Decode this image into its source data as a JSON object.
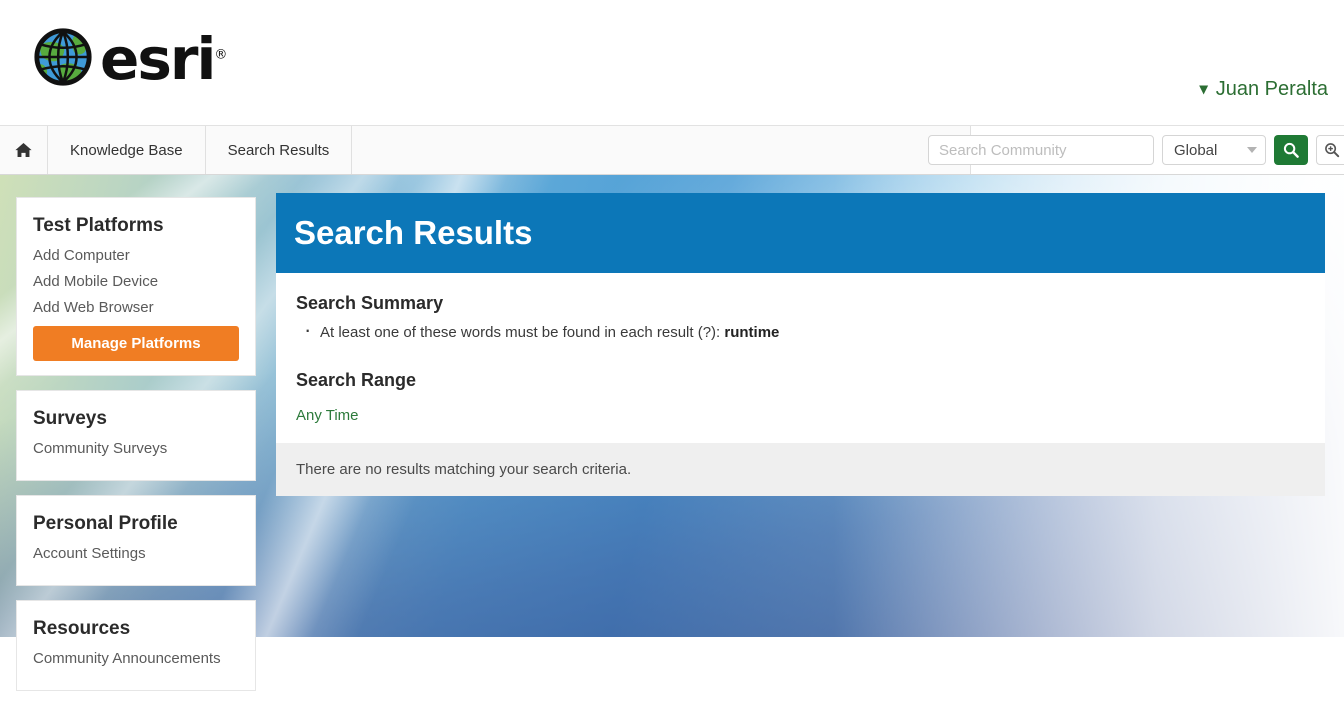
{
  "brand": {
    "logo_text": "esri",
    "registered_mark": "®",
    "globe_green": "#4a9e3f",
    "globe_blue": "#2f8fd0"
  },
  "header": {
    "user_name": "Juan Peralta",
    "user_menu_color": "#2c6e33",
    "chevron_icon": "chevron-down-icon"
  },
  "nav": {
    "home_icon": "home-icon",
    "items": [
      {
        "label": "Knowledge Base"
      },
      {
        "label": "Search Results"
      }
    ],
    "search": {
      "placeholder": "Search Community",
      "value": "",
      "scope_selected": "Global",
      "scope_options": [
        "Global"
      ],
      "search_icon": "search-icon",
      "advanced_search_icon": "advanced-search-icon",
      "button_color": "#1f7a35"
    }
  },
  "sidebar": {
    "cards": [
      {
        "title": "Test Platforms",
        "links": [
          "Add Computer",
          "Add Mobile Device",
          "Add Web Browser"
        ],
        "button": {
          "label": "Manage Platforms",
          "color": "#f07d23"
        }
      },
      {
        "title": "Surveys",
        "links": [
          "Community Surveys"
        ]
      },
      {
        "title": "Personal Profile",
        "links": [
          "Account Settings"
        ]
      },
      {
        "title": "Resources",
        "links": [
          "Community Announcements"
        ]
      }
    ]
  },
  "main": {
    "banner_title": "Search Results",
    "banner_color": "#0c77b8",
    "summary_heading": "Search Summary",
    "summary_items": [
      {
        "text": "At least one of these words must be found in each result (?): ",
        "term": "runtime"
      }
    ],
    "range_heading": "Search Range",
    "range_value": "Any Time",
    "no_results_text": "There are no results matching your search criteria."
  }
}
